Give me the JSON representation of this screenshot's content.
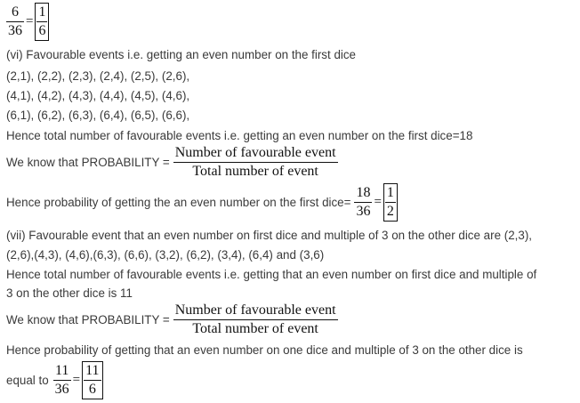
{
  "block1": {
    "num": "6",
    "den": "36",
    "eq": "=",
    "res_num": "1",
    "res_den": "6"
  },
  "lines": {
    "l_vi": "(vi) Favourable events i.e. getting an even number on the first dice",
    "l_r1": "(2,1), (2,2), (2,3), (2,4), (2,5), (2,6),",
    "l_r2": "(4,1), (4,2), (4,3), (4,4), (4,5), (4,6),",
    "l_r3": "(6,1), (6,2), (6,3), (6,4), (6,5), (6,6),",
    "l_total1": "Hence total number of favourable events i.e. getting an even number on the first dice=18",
    "l_vii_a": "(vii) Favourable event that an even number on first dice and multiple of 3 on the other dice are (2,3),",
    "l_vii_b": "(2,6),(4,3), (4,6),(6,3), (6,6), (3,2), (6,2), (3,4), (6,4) and (3,6)",
    "l_total2a": "Hence total number of favourable events i.e. getting that an even number on first dice and multiple of",
    "l_total2b": "3 on the other dice is 11",
    "l_hp2": "Hence probability of getting that an even number on one dice and multiple of 3 on the other dice is"
  },
  "prob1": {
    "prefix": "We know that PROBABILITY =",
    "num": "Number of favourable event",
    "den": "Total number of event"
  },
  "hp1": {
    "prefix": "Hence probability of getting the an even number on the first dice=",
    "num": "18",
    "den": "36",
    "eq": "=",
    "res_num": "1",
    "res_den": "2"
  },
  "prob2": {
    "prefix": "We know that PROBABILITY =",
    "num": "Number of favourable event",
    "den": "Total number of event"
  },
  "final": {
    "prefix": "equal to",
    "num": "11",
    "den": "36",
    "eq": "=",
    "res_num": "11",
    "res_den": "6"
  }
}
